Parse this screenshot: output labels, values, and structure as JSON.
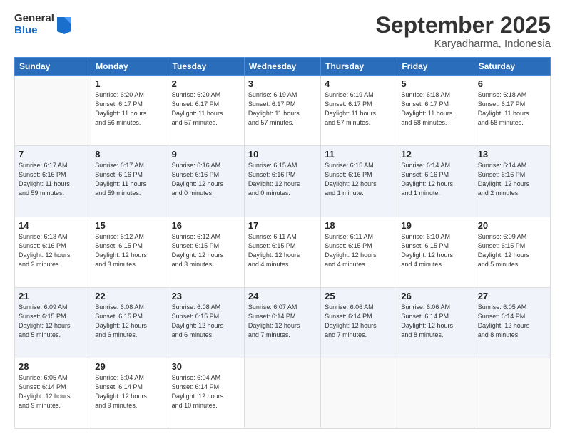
{
  "logo": {
    "general": "General",
    "blue": "Blue"
  },
  "title": "September 2025",
  "subtitle": "Karyadharma, Indonesia",
  "days_header": [
    "Sunday",
    "Monday",
    "Tuesday",
    "Wednesday",
    "Thursday",
    "Friday",
    "Saturday"
  ],
  "weeks": [
    [
      {
        "num": "",
        "info": ""
      },
      {
        "num": "1",
        "info": "Sunrise: 6:20 AM\nSunset: 6:17 PM\nDaylight: 11 hours\nand 56 minutes."
      },
      {
        "num": "2",
        "info": "Sunrise: 6:20 AM\nSunset: 6:17 PM\nDaylight: 11 hours\nand 57 minutes."
      },
      {
        "num": "3",
        "info": "Sunrise: 6:19 AM\nSunset: 6:17 PM\nDaylight: 11 hours\nand 57 minutes."
      },
      {
        "num": "4",
        "info": "Sunrise: 6:19 AM\nSunset: 6:17 PM\nDaylight: 11 hours\nand 57 minutes."
      },
      {
        "num": "5",
        "info": "Sunrise: 6:18 AM\nSunset: 6:17 PM\nDaylight: 11 hours\nand 58 minutes."
      },
      {
        "num": "6",
        "info": "Sunrise: 6:18 AM\nSunset: 6:17 PM\nDaylight: 11 hours\nand 58 minutes."
      }
    ],
    [
      {
        "num": "7",
        "info": "Sunrise: 6:17 AM\nSunset: 6:16 PM\nDaylight: 11 hours\nand 59 minutes."
      },
      {
        "num": "8",
        "info": "Sunrise: 6:17 AM\nSunset: 6:16 PM\nDaylight: 11 hours\nand 59 minutes."
      },
      {
        "num": "9",
        "info": "Sunrise: 6:16 AM\nSunset: 6:16 PM\nDaylight: 12 hours\nand 0 minutes."
      },
      {
        "num": "10",
        "info": "Sunrise: 6:15 AM\nSunset: 6:16 PM\nDaylight: 12 hours\nand 0 minutes."
      },
      {
        "num": "11",
        "info": "Sunrise: 6:15 AM\nSunset: 6:16 PM\nDaylight: 12 hours\nand 1 minute."
      },
      {
        "num": "12",
        "info": "Sunrise: 6:14 AM\nSunset: 6:16 PM\nDaylight: 12 hours\nand 1 minute."
      },
      {
        "num": "13",
        "info": "Sunrise: 6:14 AM\nSunset: 6:16 PM\nDaylight: 12 hours\nand 2 minutes."
      }
    ],
    [
      {
        "num": "14",
        "info": "Sunrise: 6:13 AM\nSunset: 6:16 PM\nDaylight: 12 hours\nand 2 minutes."
      },
      {
        "num": "15",
        "info": "Sunrise: 6:12 AM\nSunset: 6:15 PM\nDaylight: 12 hours\nand 3 minutes."
      },
      {
        "num": "16",
        "info": "Sunrise: 6:12 AM\nSunset: 6:15 PM\nDaylight: 12 hours\nand 3 minutes."
      },
      {
        "num": "17",
        "info": "Sunrise: 6:11 AM\nSunset: 6:15 PM\nDaylight: 12 hours\nand 4 minutes."
      },
      {
        "num": "18",
        "info": "Sunrise: 6:11 AM\nSunset: 6:15 PM\nDaylight: 12 hours\nand 4 minutes."
      },
      {
        "num": "19",
        "info": "Sunrise: 6:10 AM\nSunset: 6:15 PM\nDaylight: 12 hours\nand 4 minutes."
      },
      {
        "num": "20",
        "info": "Sunrise: 6:09 AM\nSunset: 6:15 PM\nDaylight: 12 hours\nand 5 minutes."
      }
    ],
    [
      {
        "num": "21",
        "info": "Sunrise: 6:09 AM\nSunset: 6:15 PM\nDaylight: 12 hours\nand 5 minutes."
      },
      {
        "num": "22",
        "info": "Sunrise: 6:08 AM\nSunset: 6:15 PM\nDaylight: 12 hours\nand 6 minutes."
      },
      {
        "num": "23",
        "info": "Sunrise: 6:08 AM\nSunset: 6:15 PM\nDaylight: 12 hours\nand 6 minutes."
      },
      {
        "num": "24",
        "info": "Sunrise: 6:07 AM\nSunset: 6:14 PM\nDaylight: 12 hours\nand 7 minutes."
      },
      {
        "num": "25",
        "info": "Sunrise: 6:06 AM\nSunset: 6:14 PM\nDaylight: 12 hours\nand 7 minutes."
      },
      {
        "num": "26",
        "info": "Sunrise: 6:06 AM\nSunset: 6:14 PM\nDaylight: 12 hours\nand 8 minutes."
      },
      {
        "num": "27",
        "info": "Sunrise: 6:05 AM\nSunset: 6:14 PM\nDaylight: 12 hours\nand 8 minutes."
      }
    ],
    [
      {
        "num": "28",
        "info": "Sunrise: 6:05 AM\nSunset: 6:14 PM\nDaylight: 12 hours\nand 9 minutes."
      },
      {
        "num": "29",
        "info": "Sunrise: 6:04 AM\nSunset: 6:14 PM\nDaylight: 12 hours\nand 9 minutes."
      },
      {
        "num": "30",
        "info": "Sunrise: 6:04 AM\nSunset: 6:14 PM\nDaylight: 12 hours\nand 10 minutes."
      },
      {
        "num": "",
        "info": ""
      },
      {
        "num": "",
        "info": ""
      },
      {
        "num": "",
        "info": ""
      },
      {
        "num": "",
        "info": ""
      }
    ]
  ]
}
